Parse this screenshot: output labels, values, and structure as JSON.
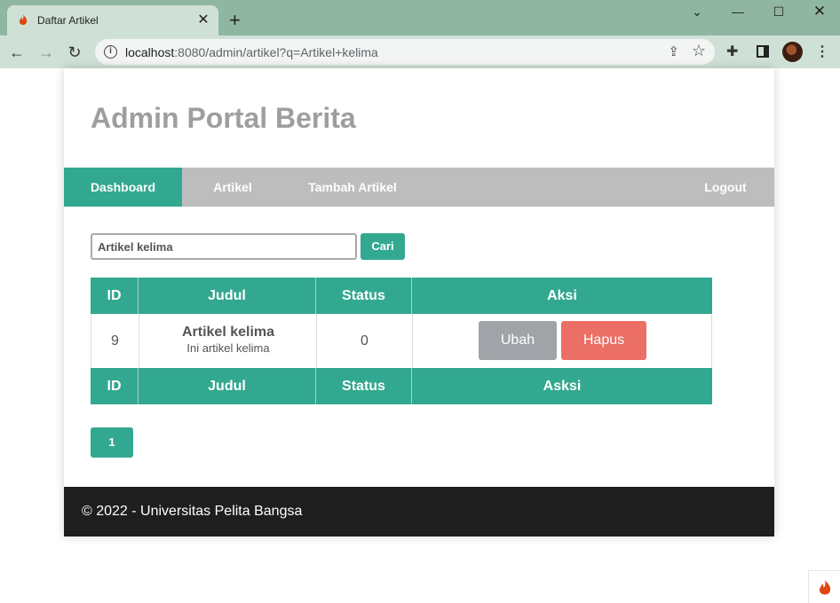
{
  "browser": {
    "tab_title": "Daftar Artikel",
    "tab_close": "✕",
    "new_tab": "+",
    "url_host": "localhost",
    "url_rest": ":8080/admin/artikel?q=Artikel+kelima",
    "window_controls": {
      "tabsearch": "⌄",
      "minimize": "—",
      "maximize": "☐",
      "close": "✕"
    }
  },
  "site": {
    "title": "Admin Portal Berita"
  },
  "nav": {
    "dashboard": "Dashboard",
    "artikel": "Artikel",
    "tambah": "Tambah Artikel",
    "logout": "Logout"
  },
  "search": {
    "value": "Artikel kelima",
    "button": "Cari"
  },
  "table": {
    "header": {
      "id": "ID",
      "judul": "Judul",
      "status": "Status",
      "aksi": "Aksi"
    },
    "rows": [
      {
        "id": "9",
        "judul": "Artikel kelima",
        "sub": "Ini artikel kelima",
        "status": "0",
        "ubah": "Ubah",
        "hapus": "Hapus"
      }
    ],
    "footer": {
      "id": "ID",
      "judul": "Judul",
      "status": "Status",
      "aksi": "Asksi"
    }
  },
  "pagination": {
    "current": "1"
  },
  "footer": {
    "text": "© 2022 - Universitas Pelita Bangsa"
  },
  "colors": {
    "accent": "#33a890",
    "danger": "#ec6f65",
    "secondary": "#a0a4a8",
    "nav_bg": "#bdbdbd",
    "footer_bg": "#1e1e1e"
  }
}
